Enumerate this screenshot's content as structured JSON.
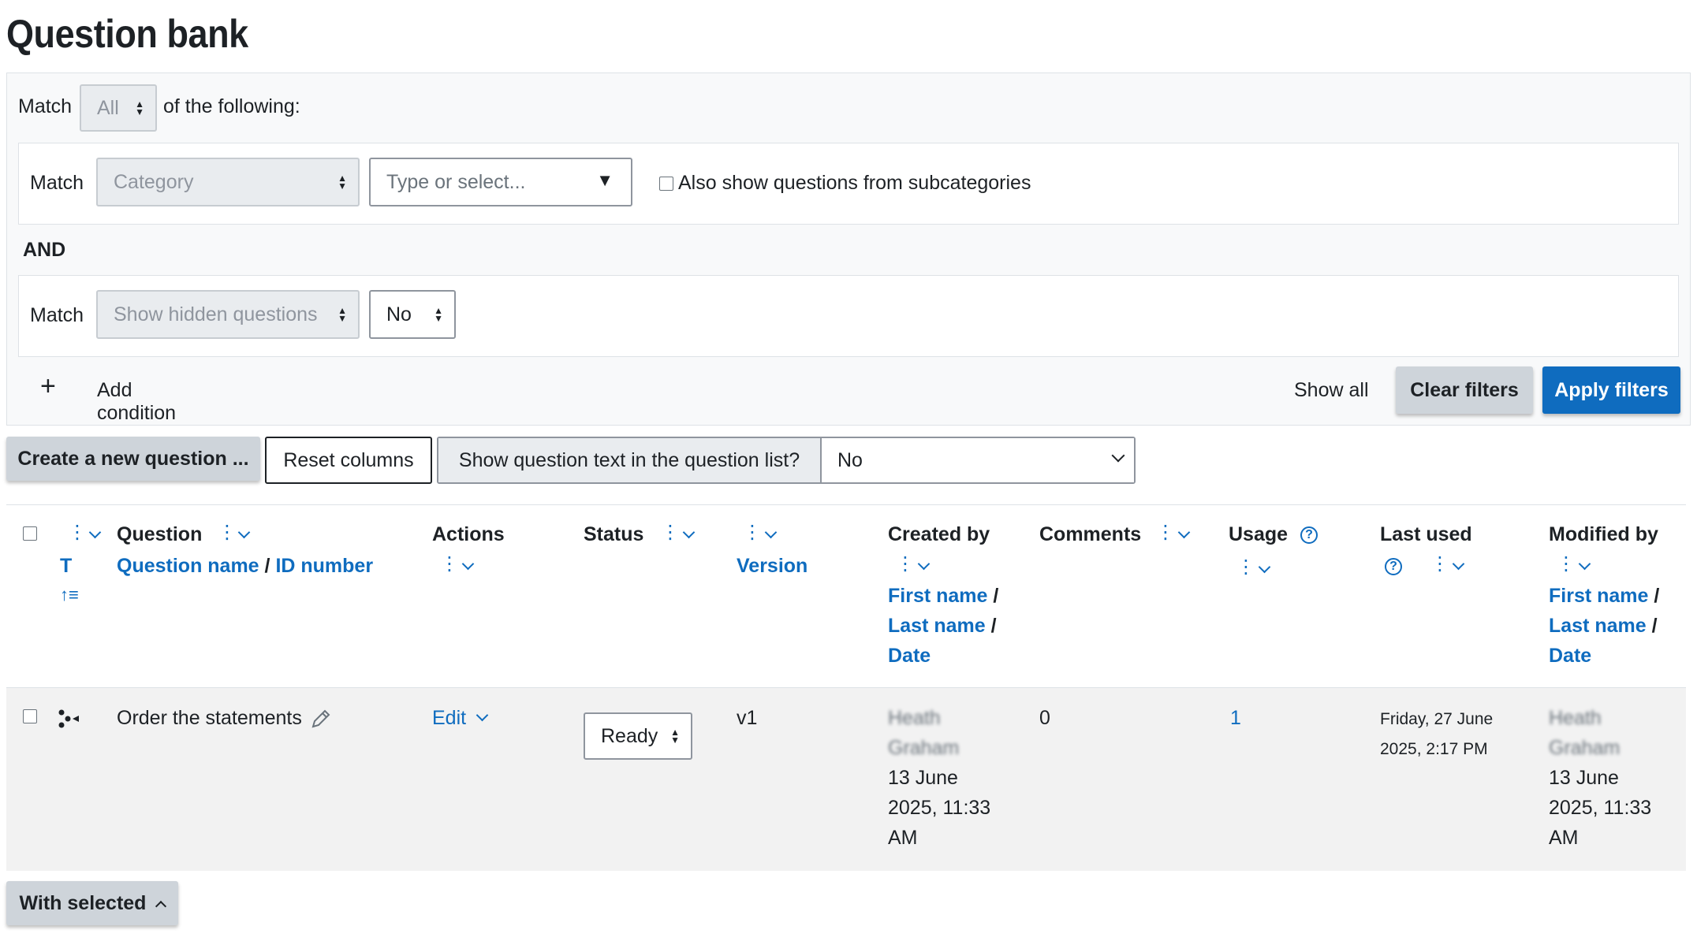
{
  "page": {
    "title": "Question bank"
  },
  "filters": {
    "match_label": "Match",
    "match_value": "All",
    "of_following": "of the following:",
    "condition1": {
      "match_label": "Match",
      "type": "Category",
      "value_placeholder": "Type or select...",
      "subcategories_label": "Also show questions from subcategories"
    },
    "and_label": "AND",
    "condition2": {
      "match_label": "Match",
      "type": "Show hidden questions",
      "value": "No"
    },
    "add_condition": "Add condition",
    "show_all": "Show all",
    "clear_filters": "Clear filters",
    "apply_filters": "Apply filters"
  },
  "toolbar": {
    "create_question": "Create a new question ...",
    "reset_columns": "Reset columns",
    "show_question_text_label": "Show question text in the question list?",
    "show_question_text_value": "No"
  },
  "table": {
    "headers": {
      "type_sort": "T",
      "question": "Question",
      "question_name": "Question name",
      "id_number": "ID number",
      "actions": "Actions",
      "status": "Status",
      "version": "Version",
      "created_by": "Created by",
      "first_name": "First name",
      "last_name": "Last name",
      "date": "Date",
      "comments": "Comments",
      "usage": "Usage",
      "last_used": "Last used",
      "modified_by": "Modified by"
    },
    "row": {
      "question": "Order the statements",
      "actions": "Edit",
      "status": "Ready",
      "version": "v1",
      "created_by_name1": "Heath",
      "created_by_name2": "Graham",
      "created_date": "13 June 2025, 11:33 AM",
      "comments": "0",
      "usage": "1",
      "last_used": "Friday, 27 June 2025, 2:17 PM",
      "modified_by_name1": "Heath",
      "modified_by_name2": "Graham",
      "modified_date": "13 June 2025, 11:33 AM"
    }
  },
  "footer": {
    "with_selected": "With selected"
  }
}
